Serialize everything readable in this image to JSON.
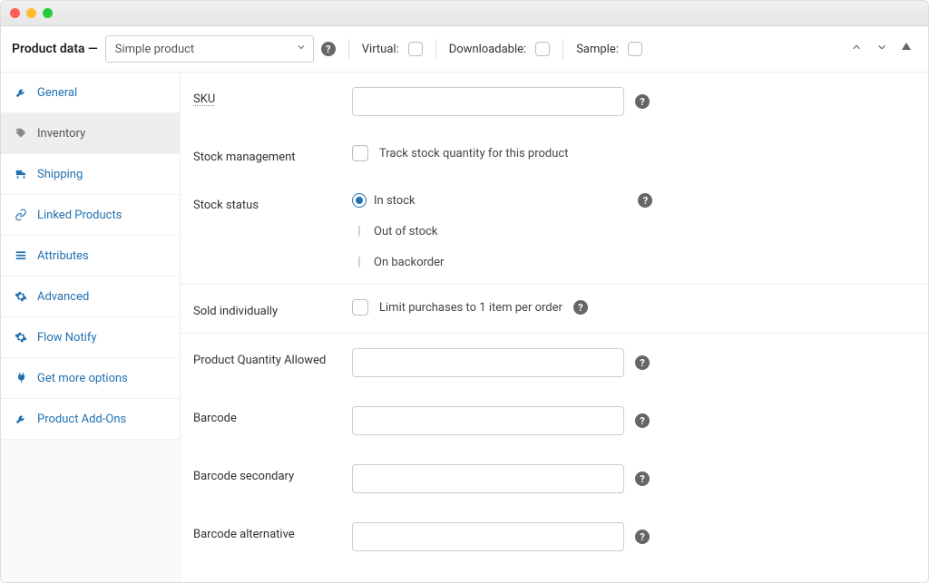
{
  "header": {
    "title": "Product data —",
    "product_type": "Simple product",
    "flags": {
      "virtual_label": "Virtual:",
      "downloadable_label": "Downloadable:",
      "sample_label": "Sample:"
    }
  },
  "sidebar": {
    "items": [
      {
        "label": "General",
        "icon": "wrench-icon"
      },
      {
        "label": "Inventory",
        "icon": "tag-icon"
      },
      {
        "label": "Shipping",
        "icon": "truck-icon"
      },
      {
        "label": "Linked Products",
        "icon": "link-icon"
      },
      {
        "label": "Attributes",
        "icon": "list-icon"
      },
      {
        "label": "Advanced",
        "icon": "gear-icon"
      },
      {
        "label": "Flow Notify",
        "icon": "gear-icon"
      },
      {
        "label": "Get more options",
        "icon": "plug-icon"
      },
      {
        "label": "Product Add-Ons",
        "icon": "wrench-icon"
      }
    ]
  },
  "form": {
    "sku": {
      "label": "SKU",
      "value": ""
    },
    "stock_management": {
      "label": "Stock management",
      "checkbox_label": "Track stock quantity for this product"
    },
    "stock_status": {
      "label": "Stock status",
      "options": [
        "In stock",
        "Out of stock",
        "On backorder"
      ],
      "selected": "In stock"
    },
    "sold_individually": {
      "label": "Sold individually",
      "checkbox_label": "Limit purchases to 1 item per order"
    },
    "product_quantity_allowed": {
      "label": "Product Quantity Allowed",
      "value": ""
    },
    "barcode": {
      "label": "Barcode",
      "value": ""
    },
    "barcode_secondary": {
      "label": "Barcode secondary",
      "value": ""
    },
    "barcode_alternative": {
      "label": "Barcode alternative",
      "value": ""
    }
  }
}
